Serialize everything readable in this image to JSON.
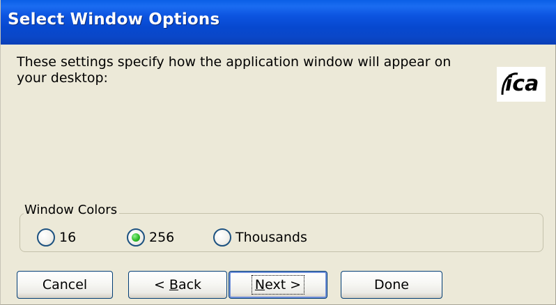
{
  "window": {
    "title": "Select Window Options"
  },
  "content": {
    "description_line1": "These settings specify how the application window will appear on",
    "description_line2": "your desktop:",
    "logo_text": "ica",
    "logo_icon": "ica-logo"
  },
  "window_colors": {
    "label": "Window Colors",
    "options": [
      {
        "label": "16",
        "selected": false
      },
      {
        "label": "256",
        "selected": true
      },
      {
        "label": "Thousands",
        "selected": false
      }
    ]
  },
  "buttons": {
    "cancel": "Cancel",
    "back_prefix": "< ",
    "back_mnemonic": "B",
    "back_rest": "ack",
    "next_mnemonic": "N",
    "next_rest": "ext >",
    "done": "Done"
  },
  "colors": {
    "title_bar": "#0a47c8",
    "dialog_bg": "#ece9d8",
    "radio_selected": "#2fbb29"
  }
}
